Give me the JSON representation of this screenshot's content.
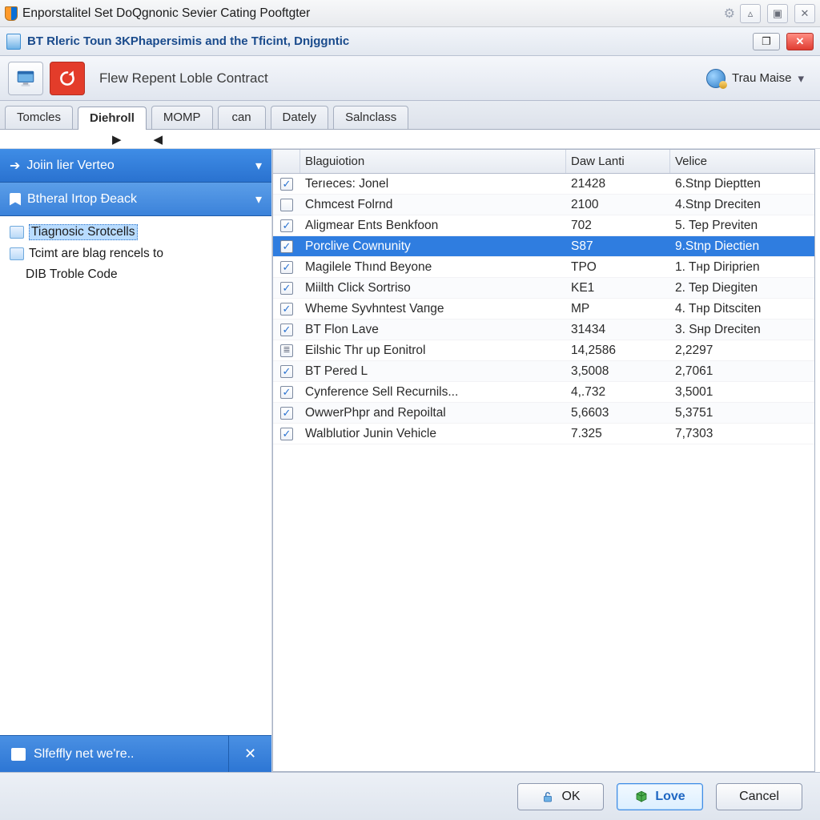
{
  "titlebar1": {
    "title": "Enporstalitel Set DoQgnonic Sevier Cating Pooftgter"
  },
  "titlebar2": {
    "title": "BT Rleric Toun 3KPhapersimis and the Tficint, Dnjggntic"
  },
  "toolbar": {
    "crumb": "Flew Repent Loble Contract",
    "user": "Trau Maise"
  },
  "tabs": [
    {
      "label": "Tomcles",
      "active": false
    },
    {
      "label": "Diehroll",
      "active": true
    },
    {
      "label": "MOMP",
      "active": false
    },
    {
      "label": "can",
      "active": false
    },
    {
      "label": "Dately",
      "active": false
    },
    {
      "label": "Salnclass",
      "active": false
    }
  ],
  "sidebar": {
    "panel1": {
      "label": "Joiin lier Verteo"
    },
    "panel2": {
      "label": "Btheral Irtop Đeack"
    },
    "tree": [
      {
        "label": "Tiagnosic Srotcells",
        "selected": true
      },
      {
        "label": "Tcimt are blag rencels to",
        "selected": false
      },
      {
        "label": "DIB Troble Code",
        "selected": false,
        "indent": true
      }
    ],
    "footer": {
      "label": "Slfeffly net we're.."
    }
  },
  "table": {
    "headers": [
      "Blaguiotion",
      "Daw Lanti",
      "Velice"
    ],
    "rows": [
      {
        "checked": true,
        "c1": "Terıeces: Jonel",
        "c2": "21428",
        "c3": "6.Stnp Dieptten",
        "selected": false
      },
      {
        "checked": false,
        "c1": "Chmcest Folrnd",
        "c2": "2100",
        "c3": "4.Stnp Dreciten",
        "selected": false
      },
      {
        "checked": true,
        "c1": "Aligmear Ents Benkfoon",
        "c2": "702",
        "c3": "5. Tep Previten",
        "selected": false
      },
      {
        "checked": true,
        "c1": "Porclive Cоwnunity",
        "c2": "S87",
        "c3": "9.Stnp Diectien",
        "selected": true
      },
      {
        "checked": true,
        "c1": "Magilele Thınd Beyone",
        "c2": "TPO",
        "c3": "1. Tнp Diriprien",
        "selected": false
      },
      {
        "checked": true,
        "c1": "Miilth Click Sortriso",
        "c2": "KE1",
        "c3": "2. Tep Diegiten",
        "selected": false
      },
      {
        "checked": true,
        "c1": "Wheme Syvhntest Vaпge",
        "c2": "MP",
        "c3": "4. Tнp Ditsciten",
        "selected": false
      },
      {
        "checked": true,
        "c1": "BT Flon Lave",
        "c2": "31434",
        "c3": "3. Sнp Dreciten",
        "selected": false
      },
      {
        "checked": "list",
        "c1": "Eilshic Thr up Eonitrol",
        "c2": "14,2586",
        "c3": "2,2297",
        "selected": false
      },
      {
        "checked": true,
        "c1": "BT Pered L",
        "c2": "3,5008",
        "c3": "2,7061",
        "selected": false
      },
      {
        "checked": true,
        "c1": "Cynference Sell Recurnils...",
        "c2": "4,.732",
        "c3": "3,5001",
        "selected": false
      },
      {
        "checked": true,
        "c1": "OwwerPhpr and Repoiltal",
        "c2": "5,6603",
        "c3": "5,3751",
        "selected": false
      },
      {
        "checked": true,
        "c1": "Walblutior Junin Vehicle",
        "c2": "7.325",
        "c3": "7,7303",
        "selected": false
      }
    ]
  },
  "footer": {
    "ok": "OK",
    "love": "Love",
    "cancel": "Cancel"
  }
}
